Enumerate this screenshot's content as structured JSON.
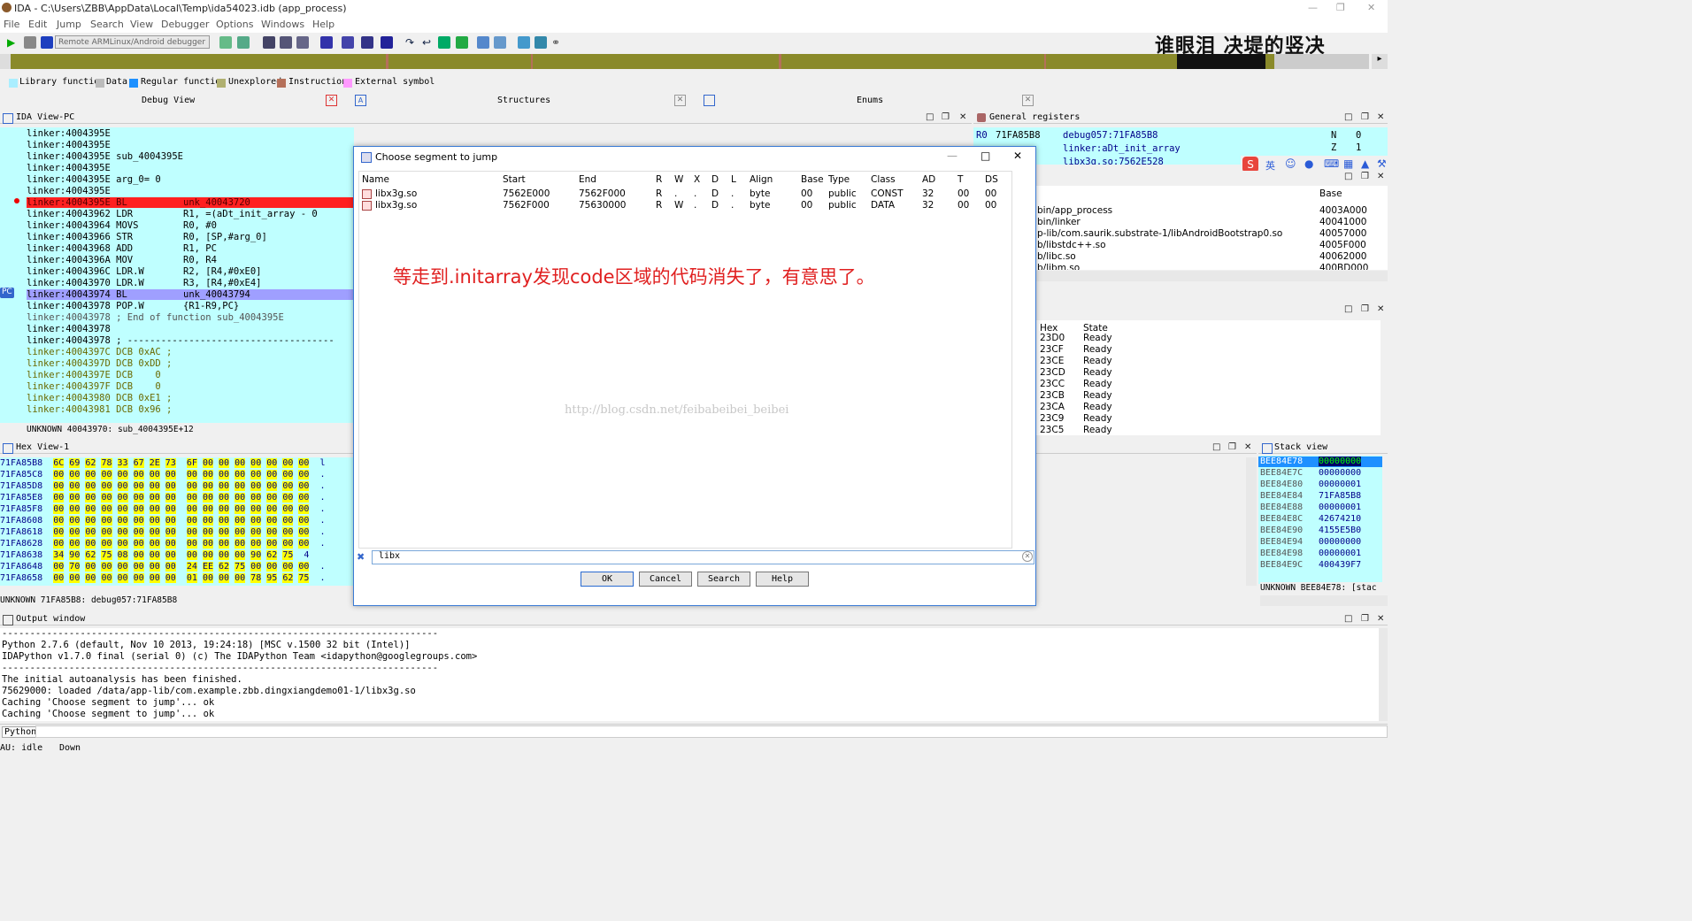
{
  "window": {
    "title": "IDA - C:\\Users\\ZBB\\AppData\\Local\\Temp\\ida54023.idb (app_process)"
  },
  "menu": [
    "File",
    "Edit",
    "Jump",
    "Search",
    "View",
    "Debugger",
    "Options",
    "Windows",
    "Help"
  ],
  "toolbar": {
    "debugger_select": "Remote ARMLinux/Android debugger"
  },
  "overlay_text": "谁眼泪 决堤的竖决",
  "legend": [
    {
      "label": "Library function",
      "color": "#aaeeff"
    },
    {
      "label": "Data",
      "color": "#bbbbbb"
    },
    {
      "label": "Regular function",
      "color": "#1e90ff"
    },
    {
      "label": "Unexplored",
      "color": "#b0b070"
    },
    {
      "label": "Instruction",
      "color": "#b5705a"
    },
    {
      "label": "External symbol",
      "color": "#ff99ff"
    }
  ],
  "tabs": [
    "Debug View",
    "Structures",
    "Enums"
  ],
  "ida_view": {
    "title": "IDA View-PC",
    "lines": [
      "linker:4004395E",
      "linker:4004395E",
      "linker:4004395E sub_4004395E",
      "linker:4004395E",
      "linker:4004395E arg_0= 0",
      "linker:4004395E",
      "linker:4004395E BL          unk_40043720",
      "linker:40043962 LDR         R1, =(aDt_init_array - 0",
      "linker:40043964 MOVS        R0, #0",
      "linker:40043966 STR         R0, [SP,#arg_0]",
      "linker:40043968 ADD         R1, PC",
      "linker:4004396A MOV         R0, R4",
      "linker:4004396C LDR.W       R2, [R4,#0xE0]",
      "linker:40043970 LDR.W       R3, [R4,#0xE4]",
      "linker:40043974 BL          unk_40043794",
      "linker:40043978 POP.W       {R1-R9,PC}",
      "linker:40043978 ; End of function sub_4004395E",
      "linker:40043978",
      "linker:40043978 ; -------------------------------------",
      "linker:4004397C DCB 0xAC ;",
      "linker:4004397D DCB 0xDD ;",
      "linker:4004397E DCB    0",
      "linker:4004397F DCB    0",
      "linker:40043980 DCB 0xE1 ;",
      "linker:40043981 DCB 0x96 ;"
    ],
    "pc_label": "PC",
    "status": "UNKNOWN 40043970: sub_4004395E+12"
  },
  "hex_view": {
    "title": "Hex View-1",
    "rows": [
      "71FA85B8  6C 69 62 78 33 67 2E 73  6F 00 00 00 00 00 00 00  l",
      "71FA85C8  00 00 00 00 00 00 00 00  00 00 00 00 00 00 00 00  .",
      "71FA85D8  00 00 00 00 00 00 00 00  00 00 00 00 00 00 00 00  .",
      "71FA85E8  00 00 00 00 00 00 00 00  00 00 00 00 00 00 00 00  .",
      "71FA85F8  00 00 00 00 00 00 00 00  00 00 00 00 00 00 00 00  .",
      "71FA8608  00 00 00 00 00 00 00 00  00 00 00 00 00 00 00 00  .",
      "71FA8618  00 00 00 00 00 00 00 00  00 00 00 00 00 00 00 00  .",
      "71FA8628  00 00 00 00 00 00 00 00  00 00 00 00 00 00 00 00  .",
      "71FA8638  34 90 62 75 08 00 00 00  00 00 00 00 90 62 75  4",
      "71FA8648  00 70 00 00 00 00 00 00  24 EE 62 75 00 00 00 00  .",
      "71FA8658  00 00 00 00 00 00 00 00  01 00 00 00 78 95 62 75  ."
    ],
    "status": "UNKNOWN 71FA85B8: debug057:71FA85B8"
  },
  "registers": {
    "title": "General registers",
    "r0_label": "R0",
    "r0_value": "71FA85B8",
    "r0_ref": "debug057:71FA85B8",
    "r1_ref": "linker:aDt_init_array",
    "r2_ref": "libx3g.so:7562E528",
    "flags": [
      {
        "name": "N",
        "val": "0"
      },
      {
        "name": "Z",
        "val": "1"
      }
    ]
  },
  "modules": {
    "header": "Base",
    "rows": [
      {
        "path": "bin/app_process",
        "base": "4003A000"
      },
      {
        "path": "bin/linker",
        "base": "40041000"
      },
      {
        "path": "p-lib/com.saurik.substrate-1/libAndroidBootstrap0.so",
        "base": "40057000"
      },
      {
        "path": "b/libstdc++.so",
        "base": "4005F000"
      },
      {
        "path": "b/libc.so",
        "base": "40062000"
      },
      {
        "path": "b/libm.so",
        "base": "400BD000"
      }
    ]
  },
  "threads": {
    "headers": [
      "Hex",
      "State"
    ],
    "rows": [
      {
        "hex": "23D0",
        "state": "Ready"
      },
      {
        "hex": "23CF",
        "state": "Ready"
      },
      {
        "hex": "23CE",
        "state": "Ready"
      },
      {
        "hex": "23CD",
        "state": "Ready"
      },
      {
        "hex": "23CC",
        "state": "Ready"
      },
      {
        "hex": "23CB",
        "state": "Ready"
      },
      {
        "hex": "23CA",
        "state": "Ready"
      },
      {
        "hex": "23C9",
        "state": "Ready"
      },
      {
        "hex": "23C5",
        "state": "Ready"
      }
    ]
  },
  "stack_view": {
    "title": "Stack view",
    "rows": [
      {
        "addr": "BEE84E78",
        "val": "00000000"
      },
      {
        "addr": "BEE84E7C",
        "val": "00000000"
      },
      {
        "addr": "BEE84E80",
        "val": "00000001"
      },
      {
        "addr": "BEE84E84",
        "val": "71FA85B8"
      },
      {
        "addr": "BEE84E88",
        "val": "00000001"
      },
      {
        "addr": "BEE84E8C",
        "val": "42674210"
      },
      {
        "addr": "BEE84E90",
        "val": "4155E5B0"
      },
      {
        "addr": "BEE84E94",
        "val": "00000000"
      },
      {
        "addr": "BEE84E98",
        "val": "00000001"
      },
      {
        "addr": "BEE84E9C",
        "val": "400439F7"
      }
    ],
    "status": "UNKNOWN BEE84E78: [stac"
  },
  "dialog": {
    "title": "Choose segment to jump",
    "headers": [
      "Name",
      "Start",
      "End",
      "R",
      "W",
      "X",
      "D",
      "L",
      "Align",
      "Base",
      "Type",
      "Class",
      "AD",
      "T",
      "DS"
    ],
    "rows": [
      [
        "libx3g.so",
        "7562E000",
        "7562F000",
        "R",
        ".",
        ".",
        "D",
        ".",
        "byte",
        "00",
        "public",
        "CONST",
        "32",
        "00",
        "00"
      ],
      [
        "libx3g.so",
        "7562F000",
        "75630000",
        "R",
        "W",
        ".",
        "D",
        ".",
        "byte",
        "00",
        "public",
        "DATA",
        "32",
        "00",
        "00"
      ]
    ],
    "annotation": "等走到.initarray发现code区域的代码消失了，有意思了。",
    "watermark": "http://blog.csdn.net/feibabeibei_beibei",
    "filter": "libx",
    "buttons": {
      "ok": "OK",
      "cancel": "Cancel",
      "search": "Search",
      "help": "Help"
    }
  },
  "output": {
    "title": "Output window",
    "lines": [
      "------------------------------------------------------------------------------",
      "Python 2.7.6 (default, Nov 10 2013, 19:24:18) [MSC v.1500 32 bit (Intel)]",
      "IDAPython v1.7.0 final (serial 0) (c) The IDAPython Team <idapython@googlegroups.com>",
      "------------------------------------------------------------------------------",
      "The initial autoanalysis has been finished.",
      "75629000: loaded /data/app-lib/com.example.zbb.dingxiangdemo01-1/libx3g.so",
      "Caching 'Choose segment to jump'... ok",
      "Caching 'Choose segment to jump'... ok"
    ]
  },
  "python_tab": "Python",
  "status": {
    "state": "AU:  idle",
    "dir": "Down"
  }
}
